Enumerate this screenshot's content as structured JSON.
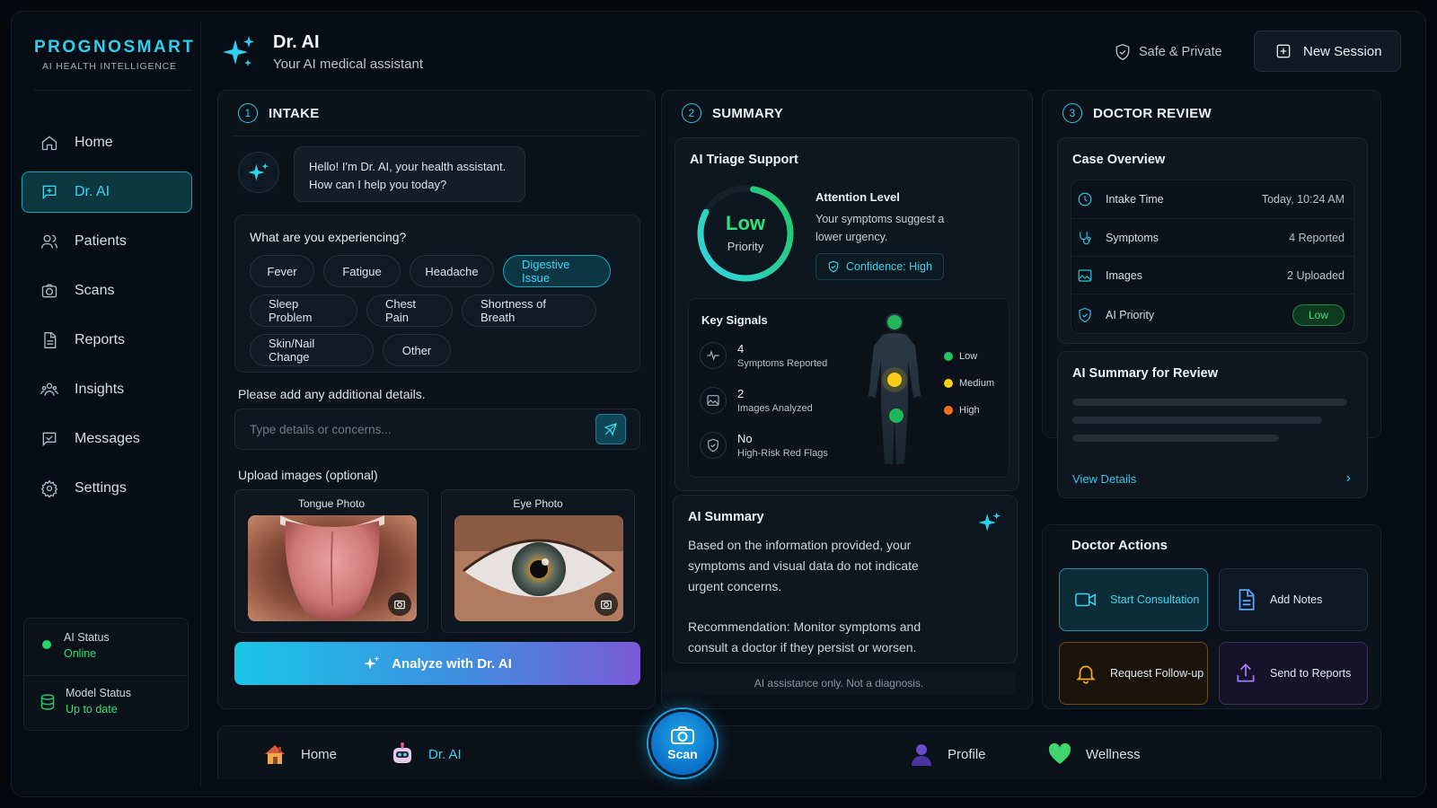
{
  "brand": {
    "title": "PROGNOSMART",
    "subtitle": "AI HEALTH INTELLIGENCE"
  },
  "sidebar": {
    "items": [
      {
        "label": "Home",
        "icon": "home-icon"
      },
      {
        "label": "Dr. AI",
        "icon": "chat-plus-icon",
        "active": true
      },
      {
        "label": "Patients",
        "icon": "users-icon"
      },
      {
        "label": "Scans",
        "icon": "camera-icon"
      },
      {
        "label": "Reports",
        "icon": "document-icon"
      },
      {
        "label": "Insights",
        "icon": "insights-icon"
      },
      {
        "label": "Messages",
        "icon": "message-icon"
      },
      {
        "label": "Settings",
        "icon": "gear-icon"
      }
    ],
    "ai_status_label": "AI Status",
    "ai_status_value": "Online",
    "model_status_label": "Model Status",
    "model_status_value": "Up to date"
  },
  "header": {
    "title": "Dr. AI",
    "subtitle": "Your AI medical assistant",
    "safe_label": "Safe & Private",
    "new_session_label": "New Session"
  },
  "intake": {
    "step": "1",
    "title": "INTAKE",
    "greeting": "Hello! I'm Dr. AI, your health assistant. How can I help you today?",
    "question": "What are you experiencing?",
    "symptoms": [
      "Fever",
      "Fatigue",
      "Headache",
      "Digestive Issue",
      "Sleep Problem",
      "Chest Pain",
      "Shortness of Breath",
      "Skin/Nail Change",
      "Other"
    ],
    "selected_symptom": "Digestive Issue",
    "details_label": "Please add any additional details.",
    "details_placeholder": "Type details or concerns...",
    "upload_label": "Upload images (optional)",
    "photo1_caption": "Tongue Photo",
    "photo2_caption": "Eye Photo",
    "analyze_label": "Analyze with Dr. AI"
  },
  "summary": {
    "step": "2",
    "title": "SUMMARY",
    "triage_title": "AI Triage Support",
    "priority_level": "Low",
    "priority_word": "Priority",
    "priority_fraction": 0.8,
    "attention_title": "Attention Level",
    "attention_text": "Your symptoms suggest a lower urgency.",
    "confidence": "Confidence: High",
    "signals_title": "Key Signals",
    "signals": [
      {
        "value": "4",
        "label": "Symptoms Reported",
        "icon": "pulse-icon"
      },
      {
        "value": "2",
        "label": "Images Analyzed",
        "icon": "image-icon"
      },
      {
        "value": "No",
        "label": "High-Risk Red Flags",
        "icon": "shield-icon"
      }
    ],
    "legend": [
      {
        "label": "Low",
        "color": "#22c55e"
      },
      {
        "label": "Medium",
        "color": "#facc15"
      },
      {
        "label": "High",
        "color": "#f97316"
      }
    ],
    "ai_summary_title": "AI Summary",
    "ai_summary_text1": "Based on the information provided, your symptoms and visual data do not indicate urgent concerns.",
    "ai_summary_text2": "Recommendation: Monitor symptoms and consult a doctor if they persist or worsen.",
    "disclaimer": "AI assistance only. Not a diagnosis."
  },
  "review": {
    "step": "3",
    "title": "DOCTOR REVIEW",
    "case_title": "Case Overview",
    "rows": [
      {
        "label": "Intake Time",
        "value": "Today, 10:24 AM"
      },
      {
        "label": "Symptoms",
        "value": "4 Reported"
      },
      {
        "label": "Images",
        "value": "2 Uploaded"
      },
      {
        "label": "AI Priority",
        "value": "Low"
      }
    ],
    "summary_title": "AI Summary for Review",
    "view_details": "View Details",
    "actions_title": "Doctor Actions",
    "actions": [
      "Start Consultation",
      "Add Notes",
      "Request Follow-up",
      "Send to Reports"
    ]
  },
  "bottom_nav": {
    "home": "Home",
    "drai": "Dr. AI",
    "scan": "Scan",
    "profile": "Profile",
    "wellness": "Wellness"
  },
  "colors": {
    "accent": "#2fd0ee",
    "success": "#2ee07a",
    "bg": "#070d14"
  }
}
